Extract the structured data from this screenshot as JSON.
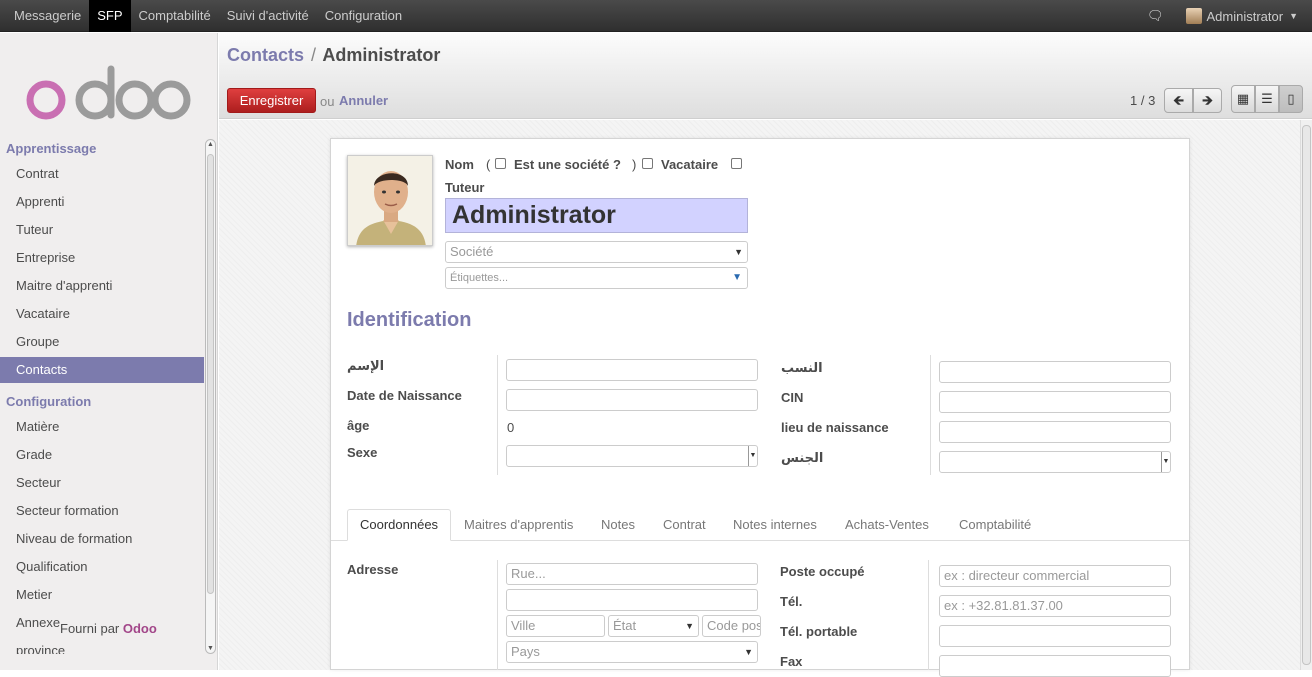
{
  "topbar": {
    "menu": [
      "Messagerie",
      "SFP",
      "Comptabilité",
      "Suivi d'activité",
      "Configuration"
    ],
    "active_index": 1,
    "user": "Administrator"
  },
  "sidebar": {
    "section1": "Apprentissage",
    "items1": [
      "Contrat",
      "Apprenti",
      "Tuteur",
      "Entreprise",
      "Maitre d'apprenti",
      "Vacataire",
      "Groupe",
      "Contacts"
    ],
    "section2": "Configuration",
    "items2": [
      "Matière",
      "Grade",
      "Secteur",
      "Secteur formation",
      "Niveau de formation",
      "Qualification",
      "Metier",
      "Annexe",
      "province"
    ],
    "footer_prefix": "Fourni par",
    "footer_brand": "Odoo",
    "logo_text": "odoo"
  },
  "header": {
    "breadcrumb_parent": "Contacts",
    "breadcrumb_sep": "/",
    "breadcrumb_current": "Administrator",
    "save_label": "Enregistrer",
    "or_text": "ou",
    "discard_label": "Annuler",
    "pager": "1 / 3"
  },
  "form": {
    "nom_label": "Nom",
    "paren_open": "(",
    "paren_close": ")",
    "is_company_label": "Est une société ?",
    "vacataire_label": "Vacataire",
    "tuteur_label": "Tuteur",
    "name_value": "Administrator",
    "company_placeholder": "Société",
    "tags_placeholder": "Étiquettes...",
    "section_title": "Identification",
    "left_labels": [
      "الإسم",
      "Date de Naissance",
      "âge",
      "Sexe"
    ],
    "age_value": "0",
    "right_labels": [
      "النسب",
      "CIN",
      "lieu de naissance",
      "الجنس"
    ],
    "tabs": [
      "Coordonnées",
      "Maitres d'apprentis",
      "Notes",
      "Contrat",
      "Notes internes",
      "Achats-Ventes",
      "Comptabilité"
    ],
    "active_tab": 0,
    "adresse_label": "Adresse",
    "rue_placeholder": "Rue...",
    "ville_placeholder": "Ville",
    "etat_placeholder": "État",
    "code_placeholder": "Code pos",
    "pays_placeholder": "Pays",
    "poste_label": "Poste occupé",
    "poste_placeholder": "ex : directeur commercial",
    "tel_label": "Tél.",
    "tel_placeholder": "ex : +32.81.81.37.00",
    "mobile_label": "Tél. portable",
    "fax_label": "Fax"
  },
  "colors": {
    "accent": "#7c7bad",
    "save": "#c02828",
    "name_bg": "#d2d2ff",
    "logo_o": "#c96fb2",
    "logo_doo": "#9b9b9b"
  }
}
